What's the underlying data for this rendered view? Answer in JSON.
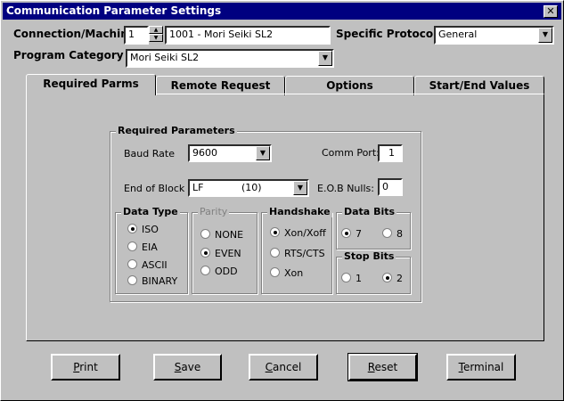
{
  "title": "Communication Parameter Settings",
  "close_glyph": "✕",
  "connection": {
    "label": "Connection/Machine",
    "number": "1",
    "name": "1001 - Mori Seiki SL2"
  },
  "protocol": {
    "label": "Specific Protocol",
    "value": "General"
  },
  "program_category": {
    "label": "Program Category",
    "value": "Mori Seiki SL2"
  },
  "tabs": [
    {
      "label": "Required Parms",
      "active": true
    },
    {
      "label": "Remote Request",
      "active": false
    },
    {
      "label": "Options",
      "active": false
    },
    {
      "label": "Start/End Values",
      "active": false
    }
  ],
  "required": {
    "title": "Required Parameters",
    "baud_label": "Baud Rate",
    "baud_value": "9600",
    "comm_port_label": "Comm Port:",
    "comm_port_value": "1",
    "eob_label": "End of Block",
    "eob_value": "LF",
    "eob_code": "(10)",
    "eob_nulls_label": "E.O.B Nulls:",
    "eob_nulls_value": "0"
  },
  "data_type": {
    "title": "Data Type",
    "options": [
      "ISO",
      "EIA",
      "ASCII",
      "BINARY"
    ],
    "selected": "ISO"
  },
  "parity": {
    "title": "Parity",
    "options": [
      "NONE",
      "EVEN",
      "ODD"
    ],
    "selected": "EVEN"
  },
  "handshake": {
    "title": "Handshake",
    "options": [
      "Xon/Xoff",
      "RTS/CTS",
      "Xon"
    ],
    "selected": "Xon/Xoff"
  },
  "data_bits": {
    "title": "Data Bits",
    "options": [
      "7",
      "8"
    ],
    "selected": "7"
  },
  "stop_bits": {
    "title": "Stop Bits",
    "options": [
      "1",
      "2"
    ],
    "selected": "2"
  },
  "buttons": {
    "print": {
      "first": "P",
      "rest": "rint"
    },
    "save": {
      "first": "S",
      "rest": "ave"
    },
    "cancel": {
      "first": "C",
      "rest": "ancel"
    },
    "reset": {
      "first": "R",
      "rest": "eset"
    },
    "terminal": {
      "first": "T",
      "rest": "erminal"
    }
  },
  "dropdown_arrow": "▼",
  "spin_up": "▲",
  "spin_down": "▼"
}
